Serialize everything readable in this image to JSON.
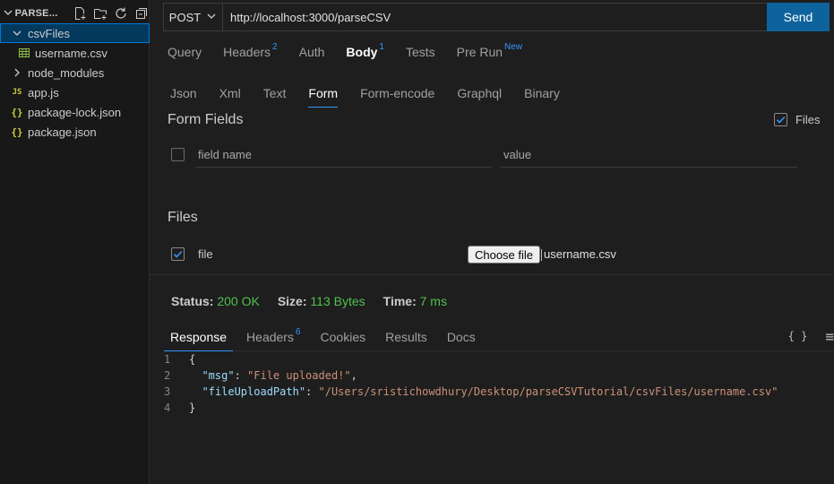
{
  "sidebar": {
    "header_title": "PARSE...",
    "tree": [
      {
        "label": "csvFiles",
        "kind": "folder-open",
        "selected": true
      },
      {
        "label": "username.csv",
        "kind": "csv"
      },
      {
        "label": "node_modules",
        "kind": "folder-closed"
      },
      {
        "label": "app.js",
        "kind": "js"
      },
      {
        "label": "package-lock.json",
        "kind": "json"
      },
      {
        "label": "package.json",
        "kind": "json"
      }
    ]
  },
  "request": {
    "method": "POST",
    "url": "http://localhost:3000/parseCSV",
    "send_label": "Send"
  },
  "tabs": [
    {
      "label": "Query",
      "badge": ""
    },
    {
      "label": "Headers",
      "badge": "2"
    },
    {
      "label": "Auth",
      "badge": ""
    },
    {
      "label": "Body",
      "badge": "1",
      "active": true
    },
    {
      "label": "Tests",
      "badge": ""
    },
    {
      "label": "Pre Run",
      "badge": "New"
    }
  ],
  "body_tabs": [
    {
      "label": "Json"
    },
    {
      "label": "Xml"
    },
    {
      "label": "Text"
    },
    {
      "label": "Form",
      "active": true
    },
    {
      "label": "Form-encode"
    },
    {
      "label": "Graphql"
    },
    {
      "label": "Binary"
    }
  ],
  "form": {
    "title": "Form Fields",
    "files_toggle_label": "Files",
    "field_name_placeholder": "field name",
    "value_placeholder": "value",
    "files_title": "Files",
    "file_field_name": "file",
    "choose_file_label": "Choose file",
    "chosen_file": "username.csv"
  },
  "status": {
    "status_label": "Status:",
    "status_value": "200 OK",
    "size_label": "Size:",
    "size_value": "113 Bytes",
    "time_label": "Time:",
    "time_value": "7 ms"
  },
  "response_tabs": [
    {
      "label": "Response",
      "badge": "",
      "active": true
    },
    {
      "label": "Headers",
      "badge": "6"
    },
    {
      "label": "Cookies",
      "badge": ""
    },
    {
      "label": "Results",
      "badge": ""
    },
    {
      "label": "Docs",
      "badge": ""
    }
  ],
  "response_icons": {
    "format": "{ }",
    "menu": "≡"
  },
  "response_body": {
    "line_numbers": [
      "1",
      "2",
      "3",
      "4"
    ],
    "open_brace": "{",
    "close_brace": "}",
    "msg_key": "\"msg\"",
    "msg_value": "\"File uploaded!\"",
    "path_key": "\"fileUploadPath\"",
    "path_value": "\"/Users/sristichowdhury/Desktop/parseCSVTutorial/csvFiles/username.csv\""
  },
  "colors": {
    "accent": "#3794ff",
    "send_button": "#0e639c",
    "status_ok": "#4ec24e",
    "selected_row": "#04395e"
  }
}
